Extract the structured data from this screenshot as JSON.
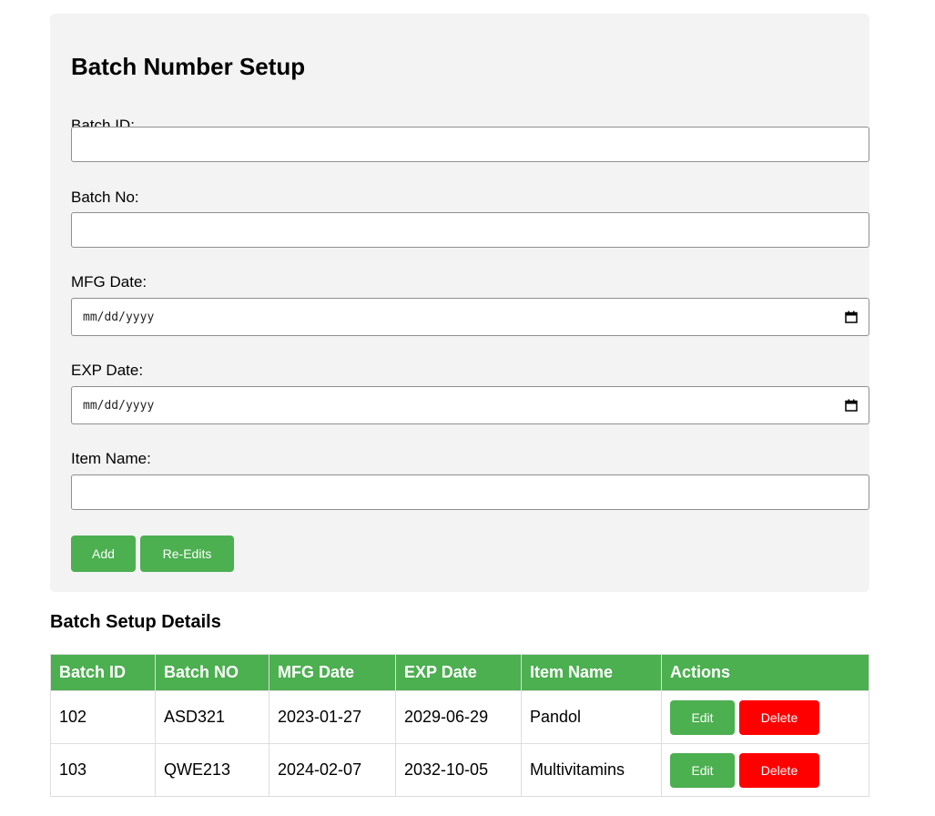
{
  "form": {
    "title": "Batch Number Setup",
    "fields": [
      {
        "label": "Batch ID:",
        "value": ""
      },
      {
        "label": "Batch No:",
        "value": ""
      },
      {
        "label": "MFG Date:",
        "placeholder": "mm/dd/yyyy"
      },
      {
        "label": "EXP Date:",
        "placeholder": "mm/dd/yyyy"
      },
      {
        "label": "Item Name:",
        "value": ""
      }
    ],
    "add_label": "Add",
    "reedits_label": "Re-Edits"
  },
  "table": {
    "title": "Batch Setup Details",
    "headers": [
      "Batch ID",
      "Batch NO",
      "MFG Date",
      "EXP Date",
      "Item Name",
      "Actions"
    ],
    "rows": [
      {
        "batch_id": "102",
        "batch_no": "ASD321",
        "mfg_date": "2023-01-27",
        "exp_date": "2029-06-29",
        "item_name": "Pandol"
      },
      {
        "batch_id": "103",
        "batch_no": "QWE213",
        "mfg_date": "2024-02-07",
        "exp_date": "2032-10-05",
        "item_name": "Multivitamins"
      }
    ],
    "edit_label": "Edit",
    "delete_label": "Delete"
  },
  "colors": {
    "accent_green": "#4caf50",
    "danger_red": "#ff0000",
    "card_bg": "#f3f3f3"
  },
  "icons": {
    "date_picker": "calendar-icon"
  }
}
